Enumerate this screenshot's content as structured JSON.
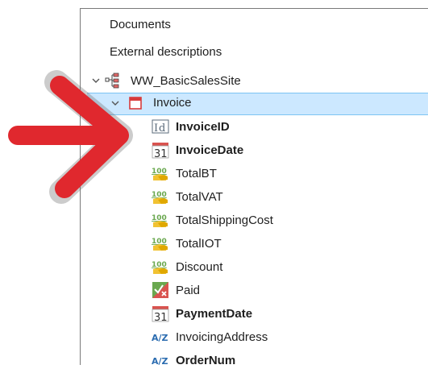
{
  "tree": {
    "documents": "Documents",
    "external_descriptions": "External descriptions",
    "site": {
      "label": "WW_BasicSalesSite",
      "icon": "site-structure-icon"
    },
    "transaction": {
      "label": "Invoice",
      "icon": "transaction-icon"
    },
    "attributes": [
      {
        "label": "InvoiceID",
        "icon": "id-icon",
        "bold": true
      },
      {
        "label": "InvoiceDate",
        "icon": "calendar-icon",
        "icon_text": "31",
        "bold": true
      },
      {
        "label": "TotalBT",
        "icon": "numeric-icon",
        "icon_text": "100",
        "bold": false
      },
      {
        "label": "TotalVAT",
        "icon": "numeric-icon",
        "icon_text": "100",
        "bold": false
      },
      {
        "label": "TotalShippingCost",
        "icon": "numeric-icon",
        "icon_text": "100",
        "bold": false
      },
      {
        "label": "TotalIOT",
        "icon": "numeric-icon",
        "icon_text": "100",
        "bold": false
      },
      {
        "label": "Discount",
        "icon": "numeric-icon",
        "icon_text": "100",
        "bold": false
      },
      {
        "label": "Paid",
        "icon": "boolean-icon",
        "bold": false
      },
      {
        "label": "PaymentDate",
        "icon": "calendar-icon",
        "icon_text": "31",
        "bold": true
      },
      {
        "label": "InvoicingAddress",
        "icon": "character-icon",
        "icon_text": "A/Z",
        "bold": false
      },
      {
        "label": "OrderNum",
        "icon": "character-icon",
        "icon_text": "A/Z",
        "bold": true
      }
    ]
  },
  "colors": {
    "selection_bg": "#cce8ff",
    "selection_border": "#7cc4f3",
    "arrow": "#e0282e",
    "arrow_shadow": "#6e6e6e",
    "transaction_icon": "#d83b3b",
    "calendar_red": "#d9534f",
    "numeric_green": "#6aa84f",
    "numeric_yellow": "#f1c232",
    "character_blue": "#2b6cb0"
  }
}
